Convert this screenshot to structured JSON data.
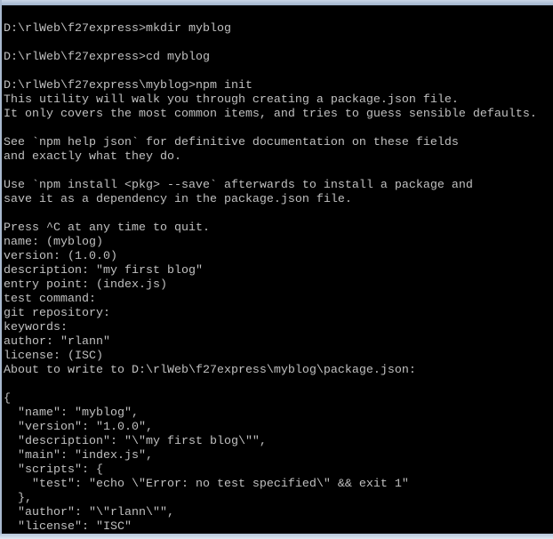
{
  "console": {
    "lines": [
      "D:\\rlWeb\\f27express>mkdir myblog",
      "",
      "D:\\rlWeb\\f27express>cd myblog",
      "",
      "D:\\rlWeb\\f27express\\myblog>npm init",
      "This utility will walk you through creating a package.json file.",
      "It only covers the most common items, and tries to guess sensible defaults.",
      "",
      "See `npm help json` for definitive documentation on these fields",
      "and exactly what they do.",
      "",
      "Use `npm install <pkg> --save` afterwards to install a package and",
      "save it as a dependency in the package.json file.",
      "",
      "Press ^C at any time to quit.",
      "name: (myblog)",
      "version: (1.0.0)",
      "description: \"my first blog\"",
      "entry point: (index.js)",
      "test command:",
      "git repository:",
      "keywords:",
      "author: \"rlann\"",
      "license: (ISC)",
      "About to write to D:\\rlWeb\\f27express\\myblog\\package.json:",
      "",
      "{",
      "  \"name\": \"myblog\",",
      "  \"version\": \"1.0.0\",",
      "  \"description\": \"\\\"my first blog\\\"\",",
      "  \"main\": \"index.js\",",
      "  \"scripts\": {",
      "    \"test\": \"echo \\\"Error: no test specified\\\" && exit 1\"",
      "  },",
      "  \"author\": \"\\\"rlann\\\"\",",
      "  \"license\": \"ISC\""
    ],
    "text_color": "#c0c0c0",
    "background_color": "#000000"
  }
}
